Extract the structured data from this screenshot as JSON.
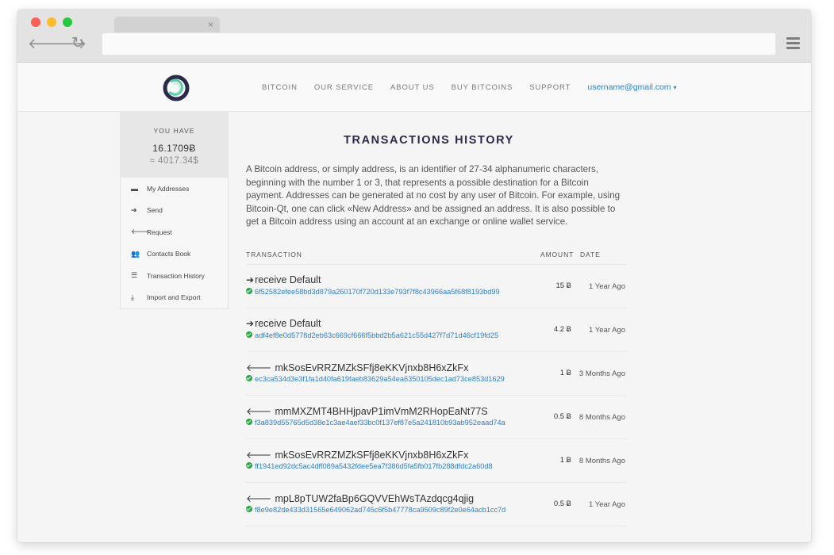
{
  "browser": {
    "tab_close": "×",
    "back_icon": "arrow-left-icon",
    "forward_icon": "arrow-right-icon",
    "reload_icon": "reload-icon",
    "menu_icon": "hamburger-menu-icon"
  },
  "nav": {
    "items": [
      "BITCOIN",
      "OUR SERVICE",
      "ABOUT US",
      "BUY BITCOINS",
      "SUPPORT"
    ],
    "user": "username@gmail.com",
    "caret": "▾"
  },
  "sidebar": {
    "balance_label": "YOU HAVE",
    "balance_btc": "16.1709Ƀ",
    "balance_usd": "≈ 4017.34$",
    "items": [
      {
        "label": "My Addresses",
        "icon": "briefcase-icon",
        "glyph": "▬"
      },
      {
        "label": "Send",
        "icon": "arrow-right-icon",
        "glyph": "➔"
      },
      {
        "label": "Request",
        "icon": "arrow-left-icon",
        "glyph": "🡐"
      },
      {
        "label": "Contacts Book",
        "icon": "users-icon",
        "glyph": "👥"
      },
      {
        "label": "Transaction History",
        "icon": "list-icon",
        "glyph": "☰"
      },
      {
        "label": "Import and Export",
        "icon": "download-icon",
        "glyph": "⤓"
      }
    ]
  },
  "main": {
    "title": "TRANSACTIONS HISTORY",
    "intro": "A Bitcoin address, or simply address, is an identifier of 27-34 alphanumeric characters, beginning with the number 1 or 3, that represents a possible destination for a Bitcoin payment. Addresses can be generated at no cost by any user of Bitcoin. For example, using Bitcoin-Qt, one can click «New Address» and be assigned an address. It is also possible to get a Bitcoin address using an account at an exchange or online wallet service.",
    "columns": {
      "transaction": "TRANSACTION",
      "amount": "AMOUNT",
      "date": "DATE"
    },
    "transactions": [
      {
        "arrow": "➔",
        "title": "receive Default",
        "hash": "6f52582efee58bd3d879a260170f720d133e793f7f8c43966aa5f68f8193bd99",
        "amount": "15 Ƀ",
        "date": "1 Year Ago"
      },
      {
        "arrow": "➔",
        "title": "receive Default",
        "hash": "adf4ef8e0d5778d2eb63c669cf666f5bbd2b5a621c55d427f7d71d46cf19fd25",
        "amount": "4.2 Ƀ",
        "date": "1 Year Ago"
      },
      {
        "arrow": "🡐 ",
        "title": "mkSosEvRRZMZkSFfj8eKKVjnxb8H6xZkFx",
        "hash": "ec3ca534d3e3f1fa1d40fa619faeb83629a54ea6350105dec1ad73ce853d1629",
        "amount": "1 Ƀ",
        "date": "3 Months Ago"
      },
      {
        "arrow": "🡐 ",
        "title": "mmMXZMT4BHHjpavP1imVmM2RHopEaNt77S",
        "hash": "f3a839d55765d5d38e1c3ae4aef33bc0f137ef87e5a241810b93ab952eaad74a",
        "amount": "0.5 Ƀ",
        "date": "8 Months Ago"
      },
      {
        "arrow": "🡐 ",
        "title": "mkSosEvRRZMZkSFfj8eKKVjnxb8H6xZkFx",
        "hash": "ff1941ed92dc5ac4dff089a5432fdee5ea7f386d5fa5fb017fb288dfdc2a60d8",
        "amount": "1 Ƀ",
        "date": "8 Months Ago"
      },
      {
        "arrow": "🡐 ",
        "title": "mpL8pTUW2faBp6GQVVEhWsTAzdqcg4qjig",
        "hash": "f8e9e82de433d31565e649062ad745c6f5b47778ca9509c89f2e0e64acb1cc7d",
        "amount": "0.5 Ƀ",
        "date": "1 Year Ago"
      }
    ]
  },
  "colors": {
    "accent": "#2d7fd1",
    "confirmed": "#27a844",
    "title": "#2a2a4a"
  }
}
